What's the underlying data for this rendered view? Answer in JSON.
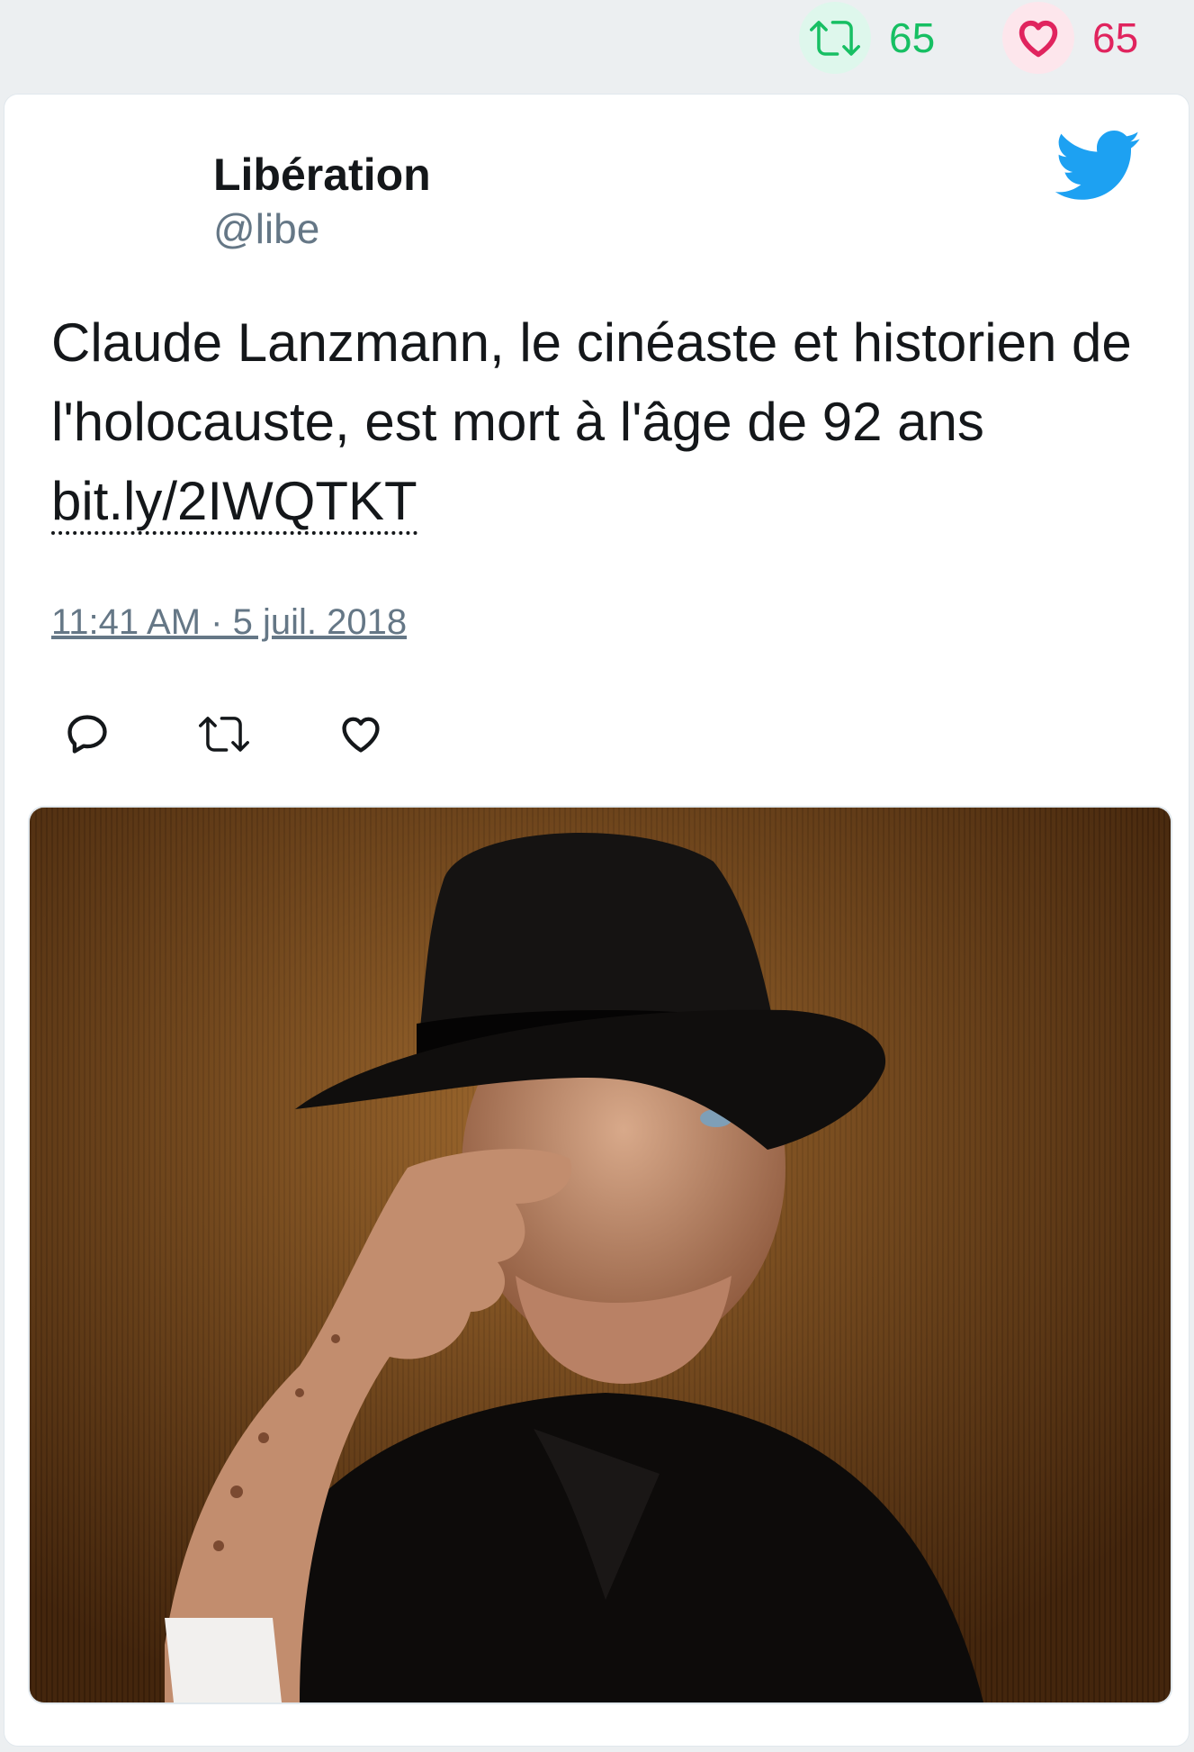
{
  "stats": {
    "retweet_icon": "retweet-icon",
    "retweet_count": "65",
    "like_icon": "heart-icon",
    "like_count": "65"
  },
  "tweet": {
    "author_name": "Libération",
    "author_handle": "@libe",
    "brand_icon": "twitter-bird-icon",
    "text_before_link": "Claude Lanzmann, le cinéaste et historien de l'holocauste, est mort à l'âge de 92 ans ",
    "link_text": "bit.ly/2IWQTKT",
    "timestamp": "11:41 AM · 5 juil. 2018",
    "actions": [
      "reply-icon",
      "retweet-icon",
      "heart-icon"
    ],
    "photo_description_icon": "photo"
  },
  "colors": {
    "retweet": "#17bf63",
    "like": "#e0245e",
    "twitter_blue": "#1da1f2",
    "muted": "#657786"
  }
}
